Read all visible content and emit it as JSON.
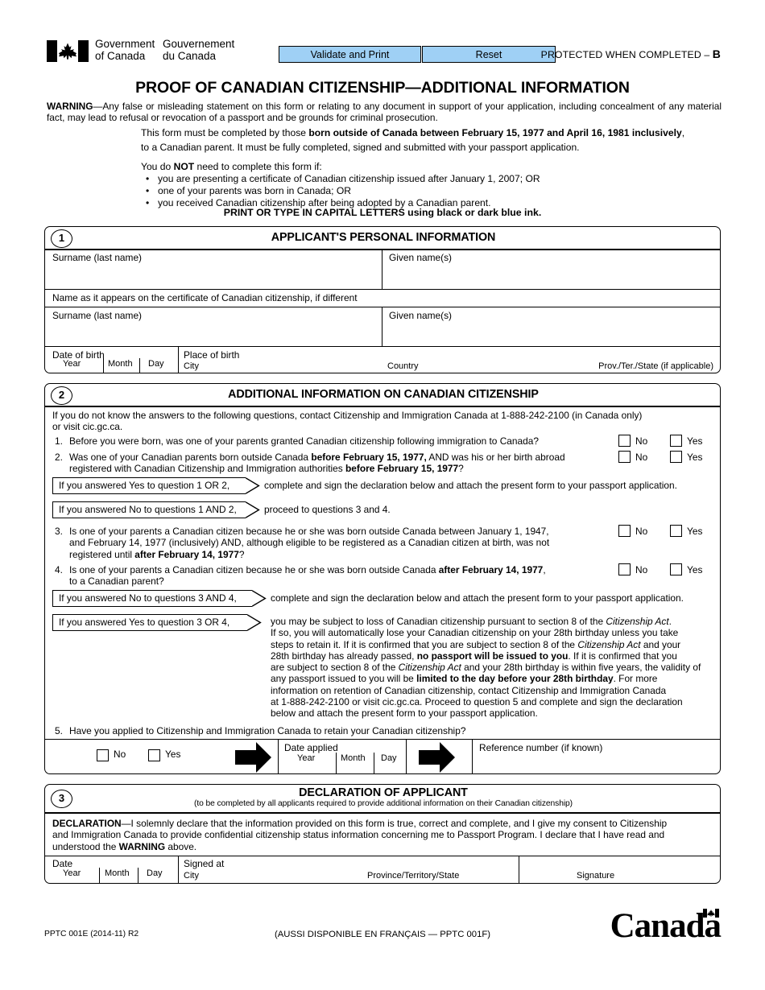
{
  "header": {
    "gov_en": "Government\nof Canada",
    "gov_fr": "Gouvernement\ndu Canada",
    "validate_button": "Validate and Print",
    "reset_button": "Reset",
    "protected_text": "PROTECTED WHEN COMPLETED – ",
    "protected_level": "B",
    "flag_icon": "canada-flag-icon"
  },
  "title": "PROOF OF CANADIAN CITIZENSHIP—ADDITIONAL INFORMATION",
  "warning": {
    "label": "WARNING",
    "text": "—Any false or misleading statement on this form or relating to any document in support of your application, including concealment of any material fact, may lead to refusal or revocation of a passport and be grounds for criminal prosecution."
  },
  "intro": {
    "line1_a": "This form must be completed by those ",
    "line1_b": "born outside of Canada between February 15, 1977 and April 16, 1981 inclusively",
    "line1_c": ",",
    "line2": "to a Canadian parent. It must be fully completed, signed and submitted with your passport application.",
    "not_needed_lead_a": "You do ",
    "not_needed_lead_b": "NOT",
    "not_needed_lead_c": " need to complete this form if:",
    "bullets": [
      "you are presenting a certificate of Canadian citizenship issued after January 1, 2007; OR",
      "one of your parents was born in Canada; OR",
      "you received Canadian citizenship after being adopted by a Canadian parent."
    ],
    "print_caps": "PRINT OR TYPE IN CAPITAL LETTERS using black or dark blue ink."
  },
  "section1": {
    "number": "1",
    "title": "APPLICANT'S PERSONAL INFORMATION",
    "surname_label": "Surname (last name)",
    "given_label": "Given name(s)",
    "cert_note": "Name as it appears on the certificate of Canadian citizenship, if different",
    "cert_surname_label": "Surname (last name)",
    "cert_given_label": "Given name(s)",
    "dob_label": "Date of birth",
    "year_label": "Year",
    "month_label": "Month",
    "day_label": "Day",
    "pob_label": "Place of birth",
    "city_label": "City",
    "country_label": "Country",
    "prov_label": "Prov./Ter./State (if applicable)"
  },
  "section2": {
    "number": "2",
    "title": "ADDITIONAL INFORMATION ON CANADIAN CITIZENSHIP",
    "contact_line1": "If you do not know the answers to the following questions, contact Citizenship and Immigration Canada at 1-888-242-2100 (in Canada only)",
    "contact_line2": "or visit cic.gc.ca.",
    "no_label": "No",
    "yes_label": "Yes",
    "q1": {
      "num": "1.",
      "text": "Before you were born, was one of your parents granted Canadian citizenship following immigration to Canada?"
    },
    "q2": {
      "num": "2.",
      "line1_a": "Was one of your Canadian parents born outside Canada ",
      "line1_b": "before February 15, 1977,",
      "line1_c": " AND was his or her birth abroad",
      "line2_a": "registered with Canadian Citizenship and Immigration authorities ",
      "line2_b": "before February 15, 1977",
      "line2_c": "?"
    },
    "callout1": {
      "label": "If you answered Yes to question 1 OR 2,",
      "text": "complete and sign the declaration below and attach the present form to your passport application."
    },
    "callout2": {
      "label": "If you answered No to questions 1 AND 2,",
      "text": "proceed to questions 3 and 4."
    },
    "q3": {
      "num": "3.",
      "line1": "Is one of your parents a Canadian citizen because he or she was born outside Canada between January 1, 1947,",
      "line2": "and February 14, 1977 (inclusively) AND, although eligible to be registered as a Canadian citizen at birth, was not",
      "line3_a": "registered until ",
      "line3_b": "after February 14, 1977",
      "line3_c": "?"
    },
    "q4": {
      "num": "4.",
      "line1_a": "Is one of your parents a Canadian citizen because he or she was born outside Canada ",
      "line1_b": "after February 14, 1977",
      "line1_c": ",",
      "line2": "to a Canadian parent?"
    },
    "callout3": {
      "label": "If you answered No to questions 3 AND 4,",
      "text": "complete and sign the declaration below and attach the present form to your passport application."
    },
    "callout4": {
      "label": "If you answered Yes to question 3 OR 4,",
      "p1_a": "you may be subject to loss of Canadian citizenship pursuant to section 8 of the ",
      "p1_b": "Citizenship Act",
      "p1_c": ".",
      "p2": "If so, you will automatically lose your Canadian citizenship on your 28th birthday unless you take",
      "p3_a": "steps to retain it. If it is confirmed that you are subject to section 8 of the ",
      "p3_b": "Citizenship Act",
      "p3_c": " and your",
      "p4_a": "28th birthday has already passed, ",
      "p4_b": "no passport will be issued to you",
      "p4_c": ". If it is confirmed that you",
      "p5_a": "are subject to section 8 of the ",
      "p5_b": "Citizenship Act",
      "p5_c": " and your 28th birthday is within five years, the validity of",
      "p6_a": "any passport issued to you will be ",
      "p6_b": "limited to the day before your 28th birthday",
      "p6_c": ". For more",
      "p7": "information on retention of Canadian citizenship, contact Citizenship and Immigration Canada",
      "p8": "at 1-888-242-2100 or visit cic.gc.ca. Proceed to question 5 and complete and sign the declaration",
      "p9": "below and attach the present form to your passport application."
    },
    "q5": {
      "num": "5.",
      "text": "Have you applied to Citizenship and Immigration Canada to retain your Canadian citizenship?",
      "no_label": "No",
      "yes_label": "Yes",
      "date_applied_label": "Date applied",
      "year_label": "Year",
      "month_label": "Month",
      "day_label": "Day",
      "reference_label": "Reference number (if known)",
      "arrow_icon": "right-arrow-icon"
    }
  },
  "section3": {
    "number": "3",
    "title": "DECLARATION OF APPLICANT",
    "subtitle": "(to be completed by all applicants required to provide additional information on their Canadian citizenship)",
    "decl_label": "DECLARATION",
    "decl_line1": "—I solemnly declare that the information provided on this form is true, correct and complete, and I give my consent to Citizenship",
    "decl_line2": "and Immigration Canada to provide confidential citizenship status information concerning me to Passport Program. I declare that I have read and",
    "decl_line3_a": "understood the ",
    "decl_line3_b": "WARNING",
    "decl_line3_c": " above.",
    "date_label": "Date",
    "year_label": "Year",
    "month_label": "Month",
    "day_label": "Day",
    "signed_at_label": "Signed at",
    "city_label": "City",
    "province_label": "Province/Territory/State",
    "signature_label": "Signature"
  },
  "footer": {
    "form_code": "PPTC 001E (2014-11) R2",
    "french_note": "(AUSSI DISPONIBLE EN FRANÇAIS — PPTC 001F)",
    "wordmark": "Canada",
    "wordmark_flag_icon": "canada-wordmark-flag-icon"
  },
  "colors": {
    "button_fill": "#9fd0f5",
    "border": "#000000",
    "page_bg": "#ffffff"
  }
}
